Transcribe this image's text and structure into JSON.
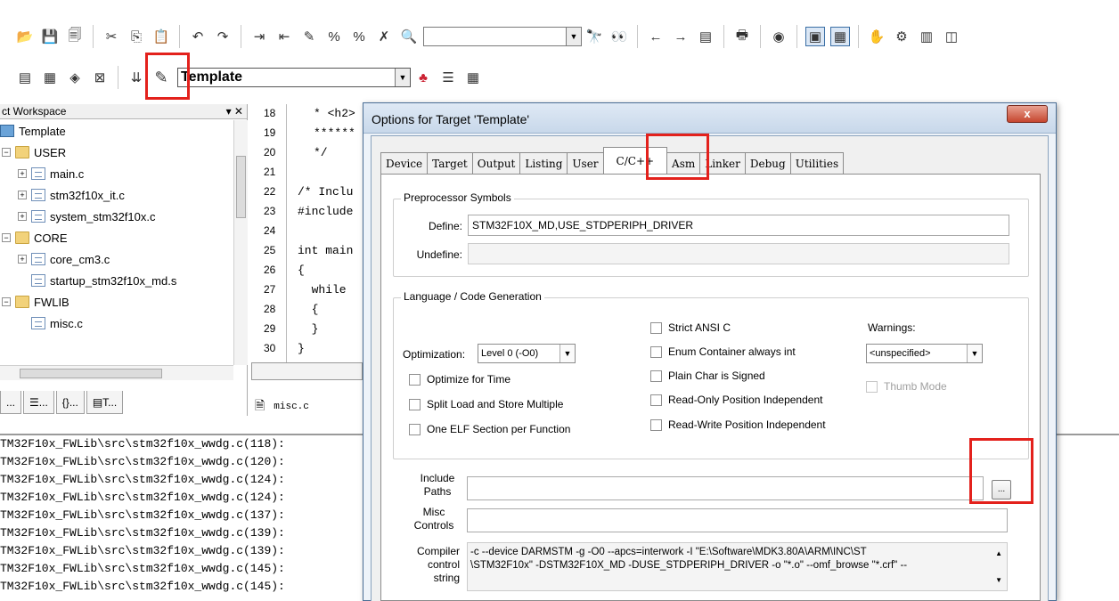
{
  "toolbar2": {
    "target_value": "Template"
  },
  "workspace": {
    "title": "ct Workspace",
    "close_glyph": "▾ ✕",
    "tree": [
      {
        "label": "Template",
        "kind": "proj"
      },
      {
        "label": "USER",
        "kind": "folder"
      },
      {
        "label": "main.c",
        "kind": "file"
      },
      {
        "label": "stm32f10x_it.c",
        "kind": "file"
      },
      {
        "label": "system_stm32f10x.c",
        "kind": "file"
      },
      {
        "label": "CORE",
        "kind": "folder"
      },
      {
        "label": "core_cm3.c",
        "kind": "file"
      },
      {
        "label": "startup_stm32f10x_md.s",
        "kind": "file"
      },
      {
        "label": "FWLIB",
        "kind": "folder"
      },
      {
        "label": "misc.c",
        "kind": "file"
      }
    ],
    "tabs": [
      "...",
      "...",
      "...",
      "T..."
    ]
  },
  "editor": {
    "lines": [
      {
        "no": "18",
        "text": "* <h2>"
      },
      {
        "no": "19",
        "text": "******"
      },
      {
        "no": "20",
        "text": "*/"
      },
      {
        "no": "21",
        "text": ""
      },
      {
        "no": "22",
        "text": "/* Inclu"
      },
      {
        "no": "23",
        "text": "#include"
      },
      {
        "no": "24",
        "text": ""
      },
      {
        "no": "25",
        "text": "int main"
      },
      {
        "no": "26",
        "text": "{"
      },
      {
        "no": "27",
        "text": "  while"
      },
      {
        "no": "28",
        "text": "  {"
      },
      {
        "no": "29",
        "text": "  }"
      },
      {
        "no": "30",
        "text": "}"
      }
    ],
    "tab_label": "misc.c"
  },
  "output": {
    "lines": [
      "TM32F10x_FWLib\\src\\stm32f10x_wwdg.c(118):",
      "TM32F10x_FWLib\\src\\stm32f10x_wwdg.c(120):",
      "TM32F10x_FWLib\\src\\stm32f10x_wwdg.c(124):",
      "TM32F10x_FWLib\\src\\stm32f10x_wwdg.c(124):",
      "TM32F10x_FWLib\\src\\stm32f10x_wwdg.c(137):",
      "TM32F10x_FWLib\\src\\stm32f10x_wwdg.c(139):",
      "TM32F10x_FWLib\\src\\stm32f10x_wwdg.c(139):",
      "TM32F10x_FWLib\\src\\stm32f10x_wwdg.c(145):",
      "TM32F10x_FWLib\\src\\stm32f10x_wwdg.c(145):"
    ]
  },
  "dialog": {
    "title": "Options for Target 'Template'",
    "close_label": "x",
    "tabs": [
      "Device",
      "Target",
      "Output",
      "Listing",
      "User",
      "C/C++",
      "Asm",
      "Linker",
      "Debug",
      "Utilities"
    ],
    "active_tab": "C/C++",
    "preprocessor": {
      "group_label": "Preprocessor Symbols",
      "define_label": "Define:",
      "define_value": "STM32F10X_MD,USE_STDPERIPH_DRIVER",
      "undefine_label": "Undefine:",
      "undefine_value": ""
    },
    "language": {
      "group_label": "Language / Code Generation",
      "optimization_label": "Optimization:",
      "optimization_value": "Level 0 (-O0)",
      "warnings_label": "Warnings:",
      "warnings_value": "<unspecified>",
      "checkboxes": {
        "optimize_for_time": "Optimize for Time",
        "split_load_store": "Split Load and Store Multiple",
        "one_elf_section": "One ELF Section per Function",
        "strict_ansi": "Strict ANSI C",
        "enum_container": "Enum Container always int",
        "plain_char_signed": "Plain Char is Signed",
        "ro_position_independent": "Read-Only Position Independent",
        "rw_position_independent": "Read-Write Position Independent",
        "thumb_mode": "Thumb Mode"
      }
    },
    "include_paths_label_1": "Include",
    "include_paths_label_2": "Paths",
    "include_paths_value": "",
    "browse_label": "...",
    "misc_label_1": "Misc",
    "misc_label_2": "Controls",
    "misc_value": "",
    "compiler_label_1": "Compiler",
    "compiler_label_2": "control",
    "compiler_label_3": "string",
    "compiler_line_1": "-c --device DARMSTM -g -O0 --apcs=interwork -I \"E:\\Software\\MDK3.80A\\ARM\\INC\\ST",
    "compiler_line_2": "\\STM32F10x\" -DSTM32F10X_MD -DUSE_STDPERIPH_DRIVER -o \"*.o\" --omf_browse \"*.crf\" --"
  },
  "colors": {
    "highlight": "#e3211c",
    "titlebar": "#c8d8ea"
  }
}
